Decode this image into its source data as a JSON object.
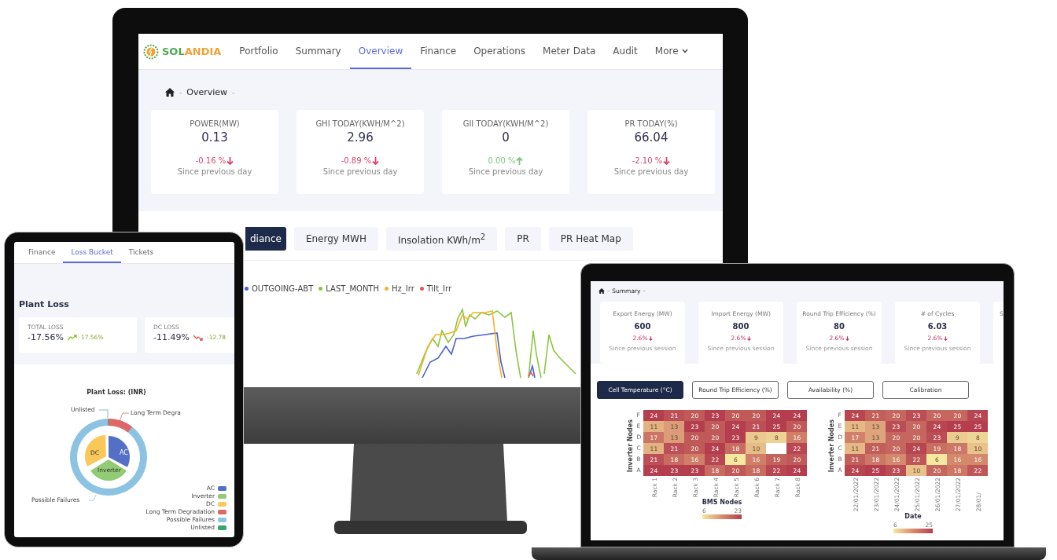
{
  "monitor": {
    "logo": "SOLANDIA",
    "nav": [
      {
        "label": "Portfolio",
        "selected": false,
        "dropdown": false
      },
      {
        "label": "Summary",
        "selected": false,
        "dropdown": false
      },
      {
        "label": "Overview",
        "selected": true,
        "dropdown": false
      },
      {
        "label": "Finance",
        "selected": false,
        "dropdown": false
      },
      {
        "label": "Operations",
        "selected": false,
        "dropdown": false
      },
      {
        "label": "Meter Data",
        "selected": false,
        "dropdown": false
      },
      {
        "label": "Audit",
        "selected": false,
        "dropdown": false
      },
      {
        "label": "More",
        "selected": false,
        "dropdown": true
      }
    ],
    "breadcrumb": {
      "separator": "-",
      "current": "Overview"
    },
    "kpis": [
      {
        "title": "POWER(MW)",
        "value": "0.13",
        "change": "-0.16 %",
        "rising": false,
        "note": "Since previous day"
      },
      {
        "title": "GHI TODAY(KWH/M^2)",
        "value": "2.96",
        "change": "-0.89 %",
        "rising": false,
        "note": "Since previous day"
      },
      {
        "title": "GII TODAY(KWH/M^2)",
        "value": "0",
        "change": "0.00 %",
        "rising": true,
        "note": "Since previous day"
      },
      {
        "title": "PR TODAY(%)",
        "value": "66.04",
        "change": "-2.10 %",
        "rising": false,
        "note": "Since previous day"
      }
    ],
    "tabs": [
      {
        "label": "diance",
        "selected": true
      },
      {
        "label": "Energy MWH",
        "selected": false
      },
      {
        "label": "Insolation KWh/m$^{2}$",
        "selected": false
      },
      {
        "label": "PR",
        "selected": false
      },
      {
        "label": "PR Heat Map",
        "selected": false
      }
    ],
    "legend": [
      {
        "name": "OUTGOING-ABT",
        "color": "#4a5fd1"
      },
      {
        "name": "LAST_MONTH",
        "color": "#8cc63f"
      },
      {
        "name": "Hz_Irr",
        "color": "#f0b429"
      },
      {
        "name": "Tilt_Irr",
        "color": "#e05a5a"
      }
    ]
  },
  "tablet": {
    "tabs": [
      {
        "label": "Finance",
        "selected": false
      },
      {
        "label": "Loss Bucket",
        "selected": true
      },
      {
        "label": "Tickets",
        "selected": false
      }
    ],
    "title": "Plant Loss",
    "cards": [
      {
        "title": "TOTAL LOSS",
        "value": "-17.56%",
        "rising": true,
        "change": "17.56%"
      },
      {
        "title": "DC LOSS",
        "value": "-11.49%",
        "rising": false,
        "change": "-12.78"
      }
    ],
    "donut": {
      "title": "Plant Loss: (INR)",
      "slice_labels": [
        "AC",
        "Inverter",
        "DC"
      ],
      "callouts": [
        "Unlisted",
        "Long Term Degra",
        "Possible Failures"
      ],
      "legend": [
        {
          "name": "AC",
          "color": "#5470c6"
        },
        {
          "name": "Inverter",
          "color": "#91cc75"
        },
        {
          "name": "DC",
          "color": "#fac858"
        },
        {
          "name": "Long Term Degradation",
          "color": "#e06666"
        },
        {
          "name": "Possible Failures",
          "color": "#8cc3e3"
        },
        {
          "name": "Unlisted",
          "color": "#3ba272"
        }
      ]
    }
  },
  "laptop": {
    "breadcrumb": {
      "separator": "-",
      "current": "Summary"
    },
    "cards": [
      {
        "title": "Export Energy (MW)",
        "value": "600",
        "change": "2.6%",
        "note": "Since previous session"
      },
      {
        "title": "Import Energy (MW)",
        "value": "800",
        "change": "2.6%",
        "note": "Since previous session"
      },
      {
        "title": "Round Trip Efficiency (%)",
        "value": "80",
        "change": "2.6%",
        "note": "Since previous session"
      },
      {
        "title": "# of Cycles",
        "value": "6.03",
        "change": "2.6%",
        "note": "Since previous session"
      },
      {
        "title": "S"
      }
    ],
    "buttons": [
      {
        "label": "Cell Temperature (°C)",
        "selected": true
      },
      {
        "label": "Round Trip Efficiency (%)",
        "selected": false
      },
      {
        "label": "Availability (%)",
        "selected": false
      },
      {
        "label": "Calibration",
        "selected": false
      }
    ],
    "heatmaps": [
      {
        "ylabel": "Inverter Nodes",
        "xlabel": "BMS Nodes",
        "scale_min": "6",
        "scale_max": "23",
        "rows": [
          "F",
          "E",
          "D",
          "C",
          "B",
          "A"
        ],
        "columns": [
          "Rack 1",
          "Rack 2",
          "Rack 3",
          "Rack 4",
          "Rack 5",
          "Rack 6",
          "Rack 7",
          "Rack 8"
        ],
        "cells": [
          [
            "24",
            "21",
            "20",
            "23",
            "20",
            "20",
            "24",
            "24"
          ],
          [
            "11",
            "13",
            "23",
            "20",
            "24",
            "21",
            "25",
            "20"
          ],
          [
            "17",
            "13",
            "20",
            "20",
            "23",
            "9",
            "8",
            "16"
          ],
          [
            "11",
            "21",
            "20",
            "24",
            "18",
            "10",
            null,
            "22"
          ],
          [
            "21",
            "18",
            "16",
            "22",
            "6",
            "16",
            "19",
            "20"
          ],
          [
            "24",
            "23",
            "23",
            "18",
            "20",
            "18",
            "22",
            "24"
          ]
        ]
      },
      {
        "ylabel": "Inverter Nodes",
        "xlabel": "Date",
        "scale_min": "6",
        "scale_max": "25",
        "rows": [
          "F",
          "E",
          "D",
          "C",
          "B",
          "A"
        ],
        "columns": [
          "22/01/2022",
          "23/01/2022",
          "24/01/2022",
          "25/01/2022",
          "26/01/2022",
          "27/01/2022",
          "28/01/"
        ],
        "cells": [
          [
            "24",
            "21",
            "20",
            "23",
            "20",
            "20",
            "24"
          ],
          [
            "11",
            "13",
            "23",
            "20",
            "24",
            "25",
            "25"
          ],
          [
            "17",
            "13",
            "20",
            "20",
            "23",
            "9",
            "8"
          ],
          [
            "11",
            "21",
            "20",
            "24",
            "19",
            "18",
            "10"
          ],
          [
            "21",
            "18",
            "16",
            "22",
            "6",
            "16",
            "16"
          ],
          [
            "24",
            "25",
            "23",
            "10",
            "20",
            "18",
            "22"
          ]
        ]
      }
    ]
  }
}
